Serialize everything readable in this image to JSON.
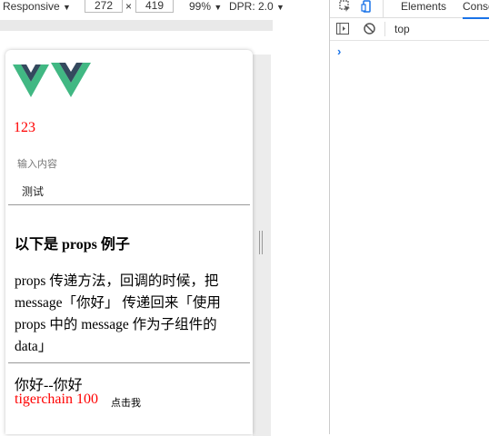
{
  "device_toolbar": {
    "device": "Responsive",
    "width": "272",
    "times": "×",
    "height": "419",
    "zoom": "99%",
    "dpr": "DPR: 2.0"
  },
  "devtools": {
    "tabs": [
      "Elements",
      "Conso"
    ],
    "context": "top",
    "prompt": "›"
  },
  "page": {
    "count": "123",
    "input_label": "输入内容",
    "input_value": "测试",
    "section_title": "以下是 props 例子",
    "description": "props 传递方法，回调的时候，把 message「你好」 传递回来「使用 props 中的 message 作为子组件的 data」",
    "greeting": "你好--你好",
    "child_name": "tigerchain 100",
    "click_button": "点击我"
  },
  "colors": {
    "vue_green": "#41b883",
    "vue_dark": "#34495e",
    "accent_red": "#ff0000",
    "devtools_blue": "#1a73e8"
  }
}
